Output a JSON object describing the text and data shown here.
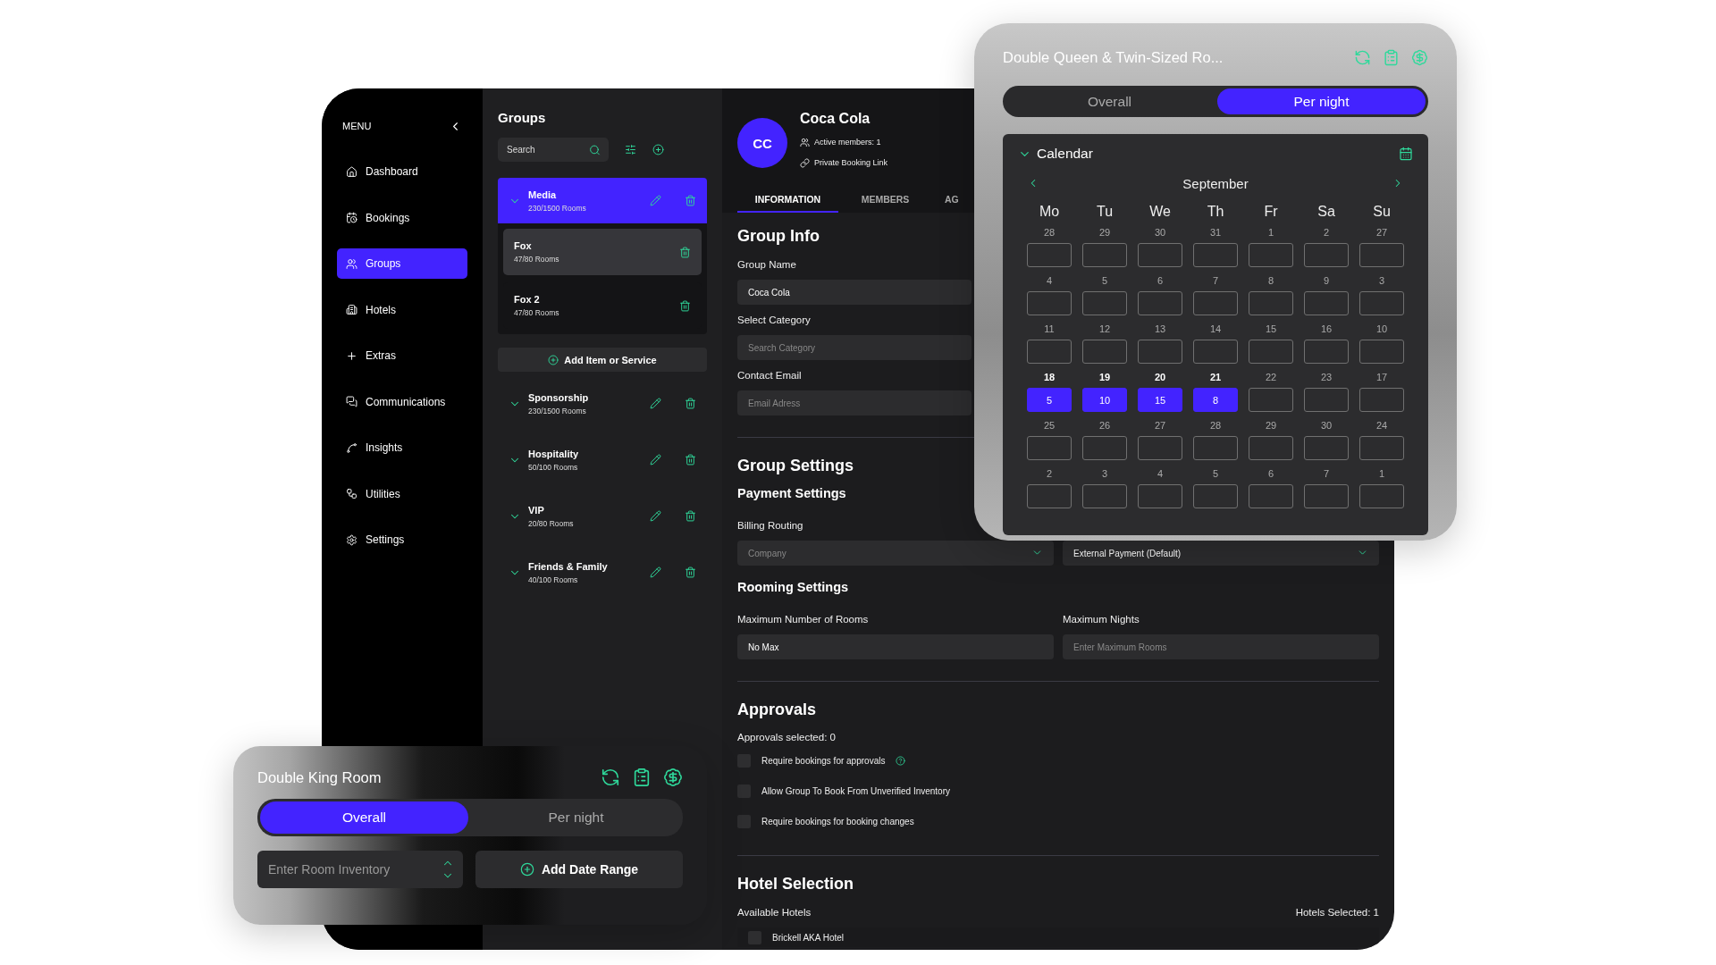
{
  "sidebar": {
    "title": "MENU",
    "items": [
      {
        "label": "Dashboard",
        "selected": false
      },
      {
        "label": "Bookings",
        "selected": false
      },
      {
        "label": "Groups",
        "selected": true
      },
      {
        "label": "Hotels",
        "selected": false
      },
      {
        "label": "Extras",
        "selected": false
      },
      {
        "label": "Communications",
        "selected": false
      },
      {
        "label": "Insights",
        "selected": false
      },
      {
        "label": "Utilities",
        "selected": false
      },
      {
        "label": "Settings",
        "selected": false
      }
    ]
  },
  "groups_panel": {
    "title": "Groups",
    "search": {
      "placeholder": "Search"
    },
    "add_button": "Add Item or Service",
    "groups": [
      {
        "name": "Media",
        "rooms": "230/1500 Rooms",
        "selected": true,
        "children": [
          {
            "name": "Fox",
            "rooms": "47/80 Rooms",
            "selected": true
          },
          {
            "name": "Fox 2",
            "rooms": "47/80 Rooms",
            "selected": false
          }
        ]
      },
      {
        "name": "Sponsorship",
        "rooms": "230/1500 Rooms",
        "selected": false
      },
      {
        "name": "Hospitality",
        "rooms": "50/100 Rooms",
        "selected": false
      },
      {
        "name": "VIP",
        "rooms": "20/80 Rooms",
        "selected": false
      },
      {
        "name": "Friends & Family",
        "rooms": "40/100 Rooms",
        "selected": false
      }
    ]
  },
  "profile": {
    "initials": "CC",
    "name": "Coca Cola",
    "members": "Active members: 1",
    "link": "Private Booking Link"
  },
  "tabs": [
    {
      "label": "INFORMATION",
      "selected": true
    },
    {
      "label": "MEMBERS",
      "selected": false
    },
    {
      "label": "AG",
      "selected": false
    }
  ],
  "group_info": {
    "title": "Group Info",
    "fields": [
      {
        "label": "Group Name",
        "value": "Coca Cola"
      },
      {
        "label": "Select Category",
        "placeholder": "Search Category"
      },
      {
        "label": "Contact Email",
        "placeholder": "Email Adress"
      }
    ]
  },
  "group_settings": {
    "title": "Group Settings",
    "payment": {
      "title": "Payment Settings",
      "label": "Billing Routing",
      "selects": [
        {
          "placeholder": "Company"
        },
        {
          "value": "External Payment (Default)"
        }
      ]
    },
    "rooming": {
      "title": "Rooming Settings",
      "fields": [
        {
          "label": "Maximum Number of Rooms",
          "value": "No Max"
        },
        {
          "label": "Maximum Nights",
          "placeholder": "Enter Maximum Rooms"
        }
      ]
    }
  },
  "approvals": {
    "title": "Approvals",
    "count": "Approvals selected: 0",
    "options": [
      {
        "label": "Require bookings for approvals",
        "checked": false,
        "help": true
      },
      {
        "label": "Allow Group To Book From Unverified Inventory",
        "checked": false,
        "help": false
      },
      {
        "label": "Require bookings for booking changes",
        "checked": false,
        "help": false
      }
    ]
  },
  "hotel_selection": {
    "title": "Hotel Selection",
    "label": "Available Hotels",
    "count": "Hotels Selected: 1",
    "hotels": [
      {
        "name": "Brickell AKA Hotel",
        "checked": false
      }
    ]
  },
  "queen_card": {
    "title": "Double Queen & Twin-Sized Ro...",
    "modes": [
      {
        "label": "Overall",
        "selected": false
      },
      {
        "label": "Per night",
        "selected": true
      }
    ],
    "calendar": {
      "title": "Calendar",
      "month": "September",
      "weekdays": [
        "Mo",
        "Tu",
        "We",
        "Th",
        "Fr",
        "Sa",
        "Su"
      ],
      "weeks": [
        [
          {
            "date": "28",
            "selected": false
          },
          {
            "date": "29",
            "selected": false
          },
          {
            "date": "30",
            "selected": false
          },
          {
            "date": "31",
            "selected": false
          },
          {
            "date": "1",
            "selected": false
          },
          {
            "date": "2",
            "selected": false
          },
          {
            "date": "27",
            "selected": false
          }
        ],
        [
          {
            "date": "4",
            "selected": false
          },
          {
            "date": "5",
            "selected": false
          },
          {
            "date": "6",
            "selected": false
          },
          {
            "date": "7",
            "selected": false
          },
          {
            "date": "8",
            "selected": false
          },
          {
            "date": "9",
            "selected": false
          },
          {
            "date": "3",
            "selected": false
          }
        ],
        [
          {
            "date": "11",
            "selected": false
          },
          {
            "date": "12",
            "selected": false
          },
          {
            "date": "13",
            "selected": false
          },
          {
            "date": "14",
            "selected": false
          },
          {
            "date": "15",
            "selected": false
          },
          {
            "date": "16",
            "selected": false
          },
          {
            "date": "10",
            "selected": false
          }
        ],
        [
          {
            "date": "18",
            "value": "5",
            "selected": true
          },
          {
            "date": "19",
            "value": "10",
            "selected": true
          },
          {
            "date": "20",
            "value": "15",
            "selected": true
          },
          {
            "date": "21",
            "value": "8",
            "selected": true
          },
          {
            "date": "22",
            "selected": false
          },
          {
            "date": "23",
            "selected": false
          },
          {
            "date": "17",
            "selected": false
          }
        ],
        [
          {
            "date": "25",
            "selected": false
          },
          {
            "date": "26",
            "selected": false
          },
          {
            "date": "27",
            "selected": false
          },
          {
            "date": "28",
            "selected": false
          },
          {
            "date": "29",
            "selected": false
          },
          {
            "date": "30",
            "selected": false
          },
          {
            "date": "24",
            "selected": false
          }
        ],
        [
          {
            "date": "2",
            "selected": false
          },
          {
            "date": "3",
            "selected": false
          },
          {
            "date": "4",
            "selected": false
          },
          {
            "date": "5",
            "selected": false
          },
          {
            "date": "6",
            "selected": false
          },
          {
            "date": "7",
            "selected": false
          },
          {
            "date": "1",
            "selected": false
          }
        ]
      ]
    }
  },
  "king_card": {
    "title": "Double King Room",
    "modes": [
      {
        "label": "Overall",
        "selected": true
      },
      {
        "label": "Per night",
        "selected": false
      }
    ],
    "inventory": {
      "placeholder": "Enter Room Inventory"
    },
    "add_button": "Add Date Range"
  }
}
